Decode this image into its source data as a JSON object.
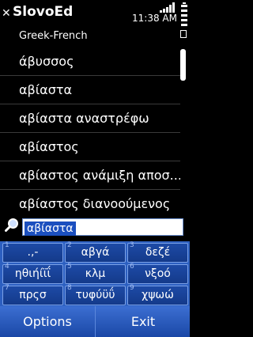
{
  "status": {
    "app_title": "SlovoEd",
    "time": "11:38 AM"
  },
  "dictionary": {
    "name": "Greek-French"
  },
  "entries": [
    "άβυσσος",
    "αβίαστα",
    "αβίαστα αναστρέφω",
    "αβίαστος",
    "αβίαστος ανάμιξη αποσ...",
    "αβίαστος διανοούμενος"
  ],
  "search": {
    "value": "αβίαστα"
  },
  "keypad": {
    "keys": [
      {
        "num": "1",
        "label": ".,-"
      },
      {
        "num": "2",
        "label": "αβγά"
      },
      {
        "num": "3",
        "label": "δεζέ"
      },
      {
        "num": "4",
        "label": "ηθιήίϊΐ"
      },
      {
        "num": "5",
        "label": "κλμ"
      },
      {
        "num": "6",
        "label": "νξοό"
      },
      {
        "num": "7",
        "label": "πρςσ"
      },
      {
        "num": "8",
        "label": "τυφύϋΰ"
      },
      {
        "num": "9",
        "label": "χψωώ"
      }
    ]
  },
  "softkeys": {
    "left": "Options",
    "right": "Exit"
  },
  "icons": [
    "close-icon",
    "signal-icon",
    "battery-icon",
    "search-icon"
  ]
}
